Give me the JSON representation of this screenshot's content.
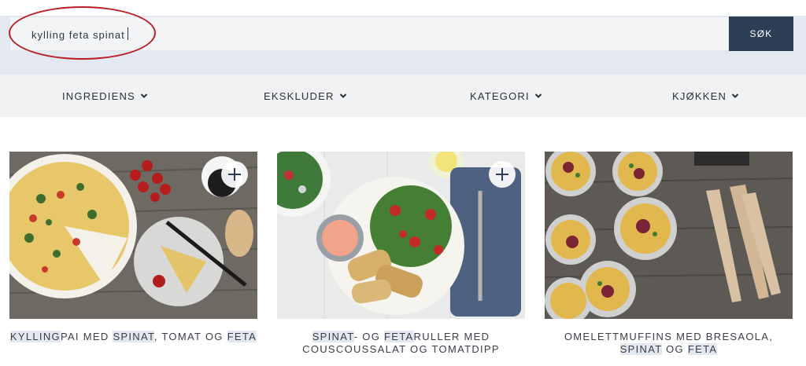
{
  "search": {
    "value": "kylling feta spinat",
    "button_label": "SØK"
  },
  "filters": [
    {
      "label": "INGREDIENS",
      "icon": "chevron-down-icon"
    },
    {
      "label": "EKSKLUDER",
      "icon": "chevron-down-icon"
    },
    {
      "label": "KATEGORI",
      "icon": "chevron-down-icon"
    },
    {
      "label": "KJØKKEN",
      "icon": "chevron-down-icon"
    }
  ],
  "cards": [
    {
      "title_parts": [
        {
          "text": "KYLLING",
          "highlight": true
        },
        {
          "text": "PAI MED ",
          "highlight": false
        },
        {
          "text": "SPINAT",
          "highlight": true
        },
        {
          "text": ", TOMAT OG ",
          "highlight": false
        },
        {
          "text": "FETA",
          "highlight": true
        }
      ],
      "image": "quiche-photo",
      "has_add_button": true
    },
    {
      "title_parts": [
        {
          "text": "SPINAT",
          "highlight": true
        },
        {
          "text": "- OG ",
          "highlight": false
        },
        {
          "text": "FETA",
          "highlight": true
        },
        {
          "text": "RULLER MED COUSCOUSSALAT OG TOMATDIPP",
          "highlight": false
        }
      ],
      "image": "salad-rolls-photo",
      "has_add_button": true
    },
    {
      "title_parts": [
        {
          "text": "OMELETTMUFFINS MED BRESAOLA, ",
          "highlight": false
        },
        {
          "text": "SPINAT",
          "highlight": true
        },
        {
          "text": " OG ",
          "highlight": false
        },
        {
          "text": "FETA",
          "highlight": true
        }
      ],
      "image": "omelette-muffins-photo",
      "has_add_button": false
    }
  ],
  "colors": {
    "search_button": "#2b3e54",
    "highlight_ring": "#b81e24",
    "title_highlight": "#e3e8ef"
  }
}
